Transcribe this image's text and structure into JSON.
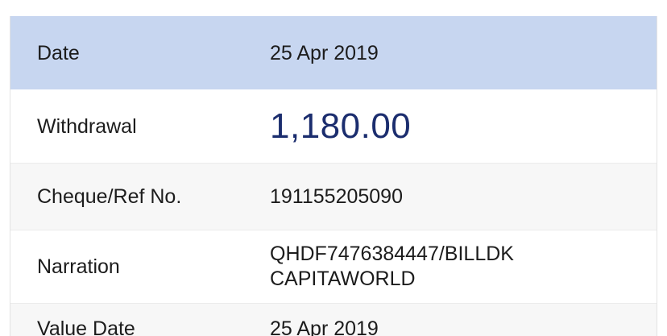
{
  "transaction": {
    "rows": [
      {
        "label": "Date",
        "value": "25 Apr 2019"
      },
      {
        "label": "Withdrawal",
        "value": "1,180.00"
      },
      {
        "label": "Cheque/Ref No.",
        "value": "191155205090"
      },
      {
        "label": "Narration",
        "value_line1": "QHDF7476384447/BILLDK",
        "value_line2": "CAPITAWORLD"
      },
      {
        "label": "Value Date",
        "value": "25 Apr 2019"
      }
    ]
  },
  "colors": {
    "header_row_bg": "#c7d6f0",
    "amount_text": "#1b2d6e",
    "alt_row_bg": "#f7f7f7"
  }
}
